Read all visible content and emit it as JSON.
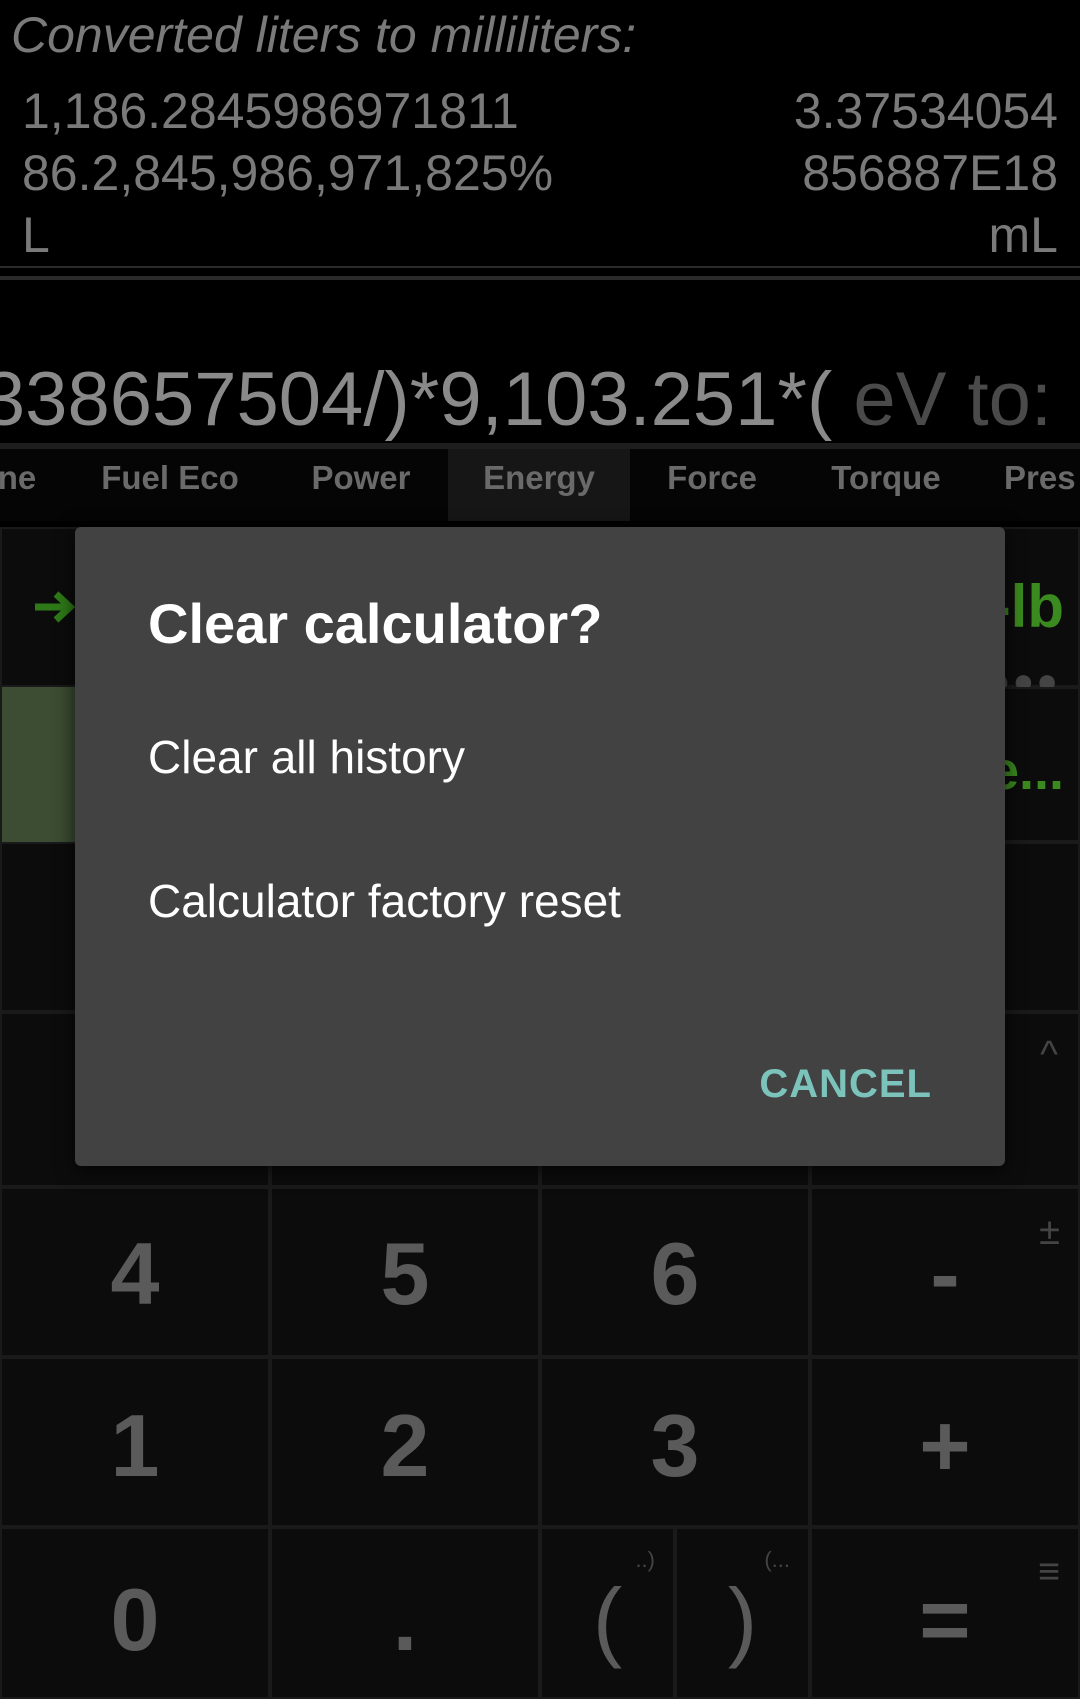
{
  "history": {
    "title": "Converted liters to milliliters:",
    "left_lines": [
      "1,186.2845986971811",
      "86.2,845,986,971,825%",
      "L"
    ],
    "right_lines": [
      "3.37534054",
      "856887E18",
      "mL"
    ]
  },
  "expression": {
    "text": "338657504/)*9,103.251*(",
    "hint": " eV to:"
  },
  "tabs": [
    "ne",
    "Fuel Eco",
    "Power",
    "Energy",
    "Force",
    "Torque",
    "Pres"
  ],
  "active_tab": "Energy",
  "unit_row": {
    "right_unit_fragment": "-lb",
    "more_fragment": "e..."
  },
  "keys": {
    "row1": [
      "4",
      "5",
      "6",
      "-"
    ],
    "row2": [
      "1",
      "2",
      "3",
      "+"
    ],
    "row3": [
      "0",
      ".",
      "(",
      ")",
      "="
    ],
    "corner_plusminus": "±",
    "corner_caret": "^",
    "corner_menu": "≡",
    "paren_open_hint": "..)",
    "paren_close_hint": "(..."
  },
  "dialog": {
    "title": "Clear calculator?",
    "option1": "Clear all history",
    "option2": "Calculator factory reset",
    "cancel": "CANCEL"
  },
  "colors": {
    "accent": "#7cc4bb",
    "unit_green": "#3b8a1f",
    "dialog_bg": "#424242"
  }
}
